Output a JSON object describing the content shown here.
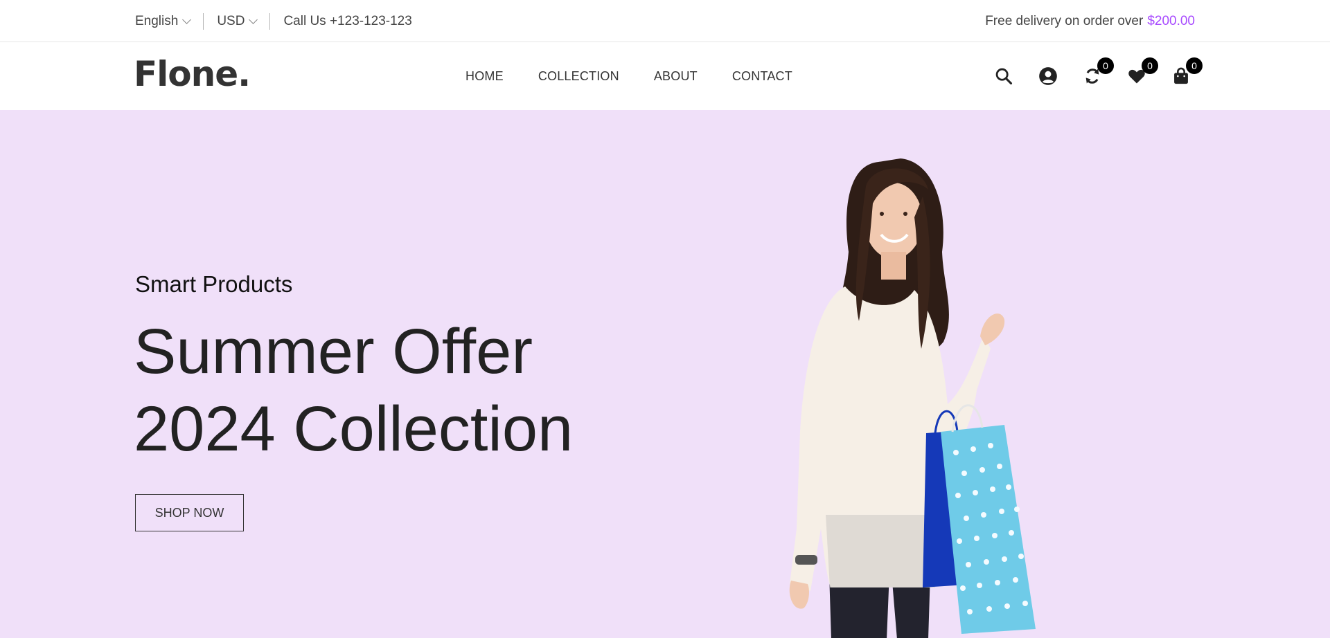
{
  "topbar": {
    "language": "English",
    "currency": "USD",
    "phone": "Call Us +123-123-123",
    "delivery_text": "Free delivery on order over",
    "delivery_amount": "$200.00"
  },
  "header": {
    "logo": "Flone.",
    "nav": [
      "HOME",
      "COLLECTION",
      "ABOUT",
      "CONTACT"
    ],
    "icons": {
      "search": "search-icon",
      "account": "user-circle-icon",
      "compare": "compare-icon",
      "wishlist": "heart-icon",
      "cart": "shopping-bag-icon"
    },
    "compare_count": "0",
    "wishlist_count": "0",
    "cart_count": "0"
  },
  "hero": {
    "subtitle": "Smart Products",
    "title_line1": "Summer Offer",
    "title_line2": "2024 Collection",
    "button": "SHOP NOW",
    "background": "#f0e0f9"
  },
  "colors": {
    "accent": "#a749ff",
    "text": "#333333"
  }
}
